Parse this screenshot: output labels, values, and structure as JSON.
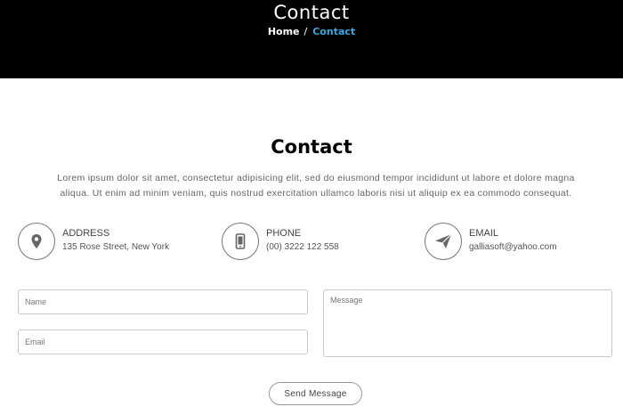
{
  "hero": {
    "title": "Contact",
    "breadcrumb": {
      "home": "Home",
      "separator": "/",
      "current": "Contact"
    }
  },
  "section": {
    "title": "Contact",
    "description": "Lorem ipsum dolor sit amet, consectetur adipisicing elit, sed do eiusmond tempor incididunt ut labore et dolore magna aliqua. Ut enim ad minim veniam, quis nostrud exercitation ullamco laboris nisi ut aliquip ex ea commodo consequat."
  },
  "info": {
    "address": {
      "label": "ADDRESS",
      "value": "135 Rose Street, New York",
      "icon": "map-pin-icon"
    },
    "phone": {
      "label": "PHONE",
      "value": "(00) 3222 122 558",
      "icon": "smartphone-icon"
    },
    "email": {
      "label": "EMAIL",
      "value": "galliasoft@yahoo.com",
      "icon": "paper-plane-icon"
    }
  },
  "form": {
    "name_placeholder": "Name",
    "email_placeholder": "Email",
    "message_placeholder": "Message",
    "send_label": "Send Message"
  },
  "colors": {
    "hero_bg": "#000000",
    "accent": "#36a9e1",
    "border": "#c9c9c9"
  }
}
